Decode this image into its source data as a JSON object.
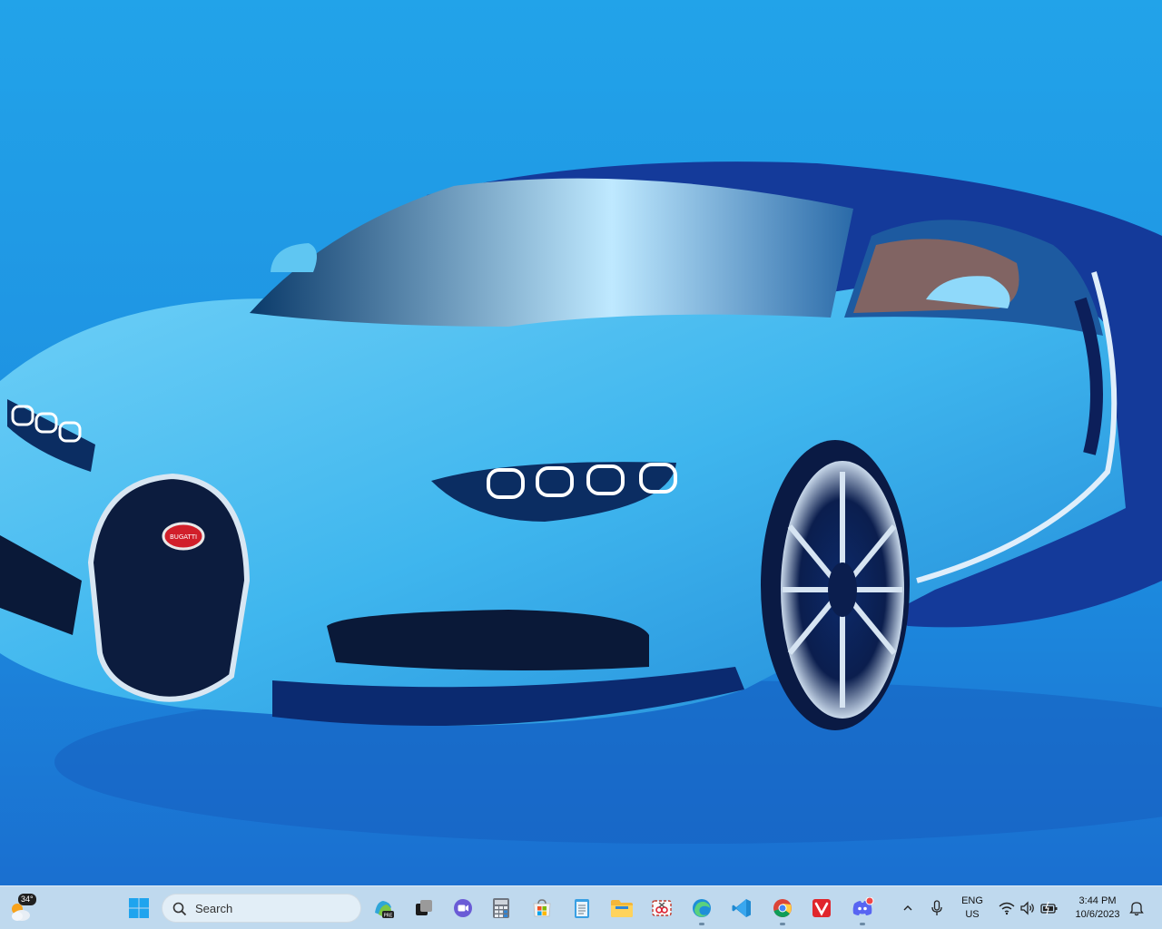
{
  "desktop": {
    "wallpaper_colors": {
      "sky_top": "#22a3e9",
      "sky_bottom": "#1872d4",
      "car_body": "#3fb6ee",
      "car_dark": "#143a9a",
      "badge_red": "#d11f2a"
    },
    "badge_text": "BUGATTI"
  },
  "taskbar": {
    "weather": {
      "temperature": "34°",
      "icon": "weather-sun-cloud-icon"
    },
    "start_icon": "windows-start-icon",
    "search": {
      "label": "Search",
      "icon": "search-icon"
    },
    "apps": [
      {
        "name": "Copilot",
        "icon": "copilot-icon"
      },
      {
        "name": "Task View",
        "icon": "task-view-icon"
      },
      {
        "name": "Teams",
        "icon": "teams-icon"
      },
      {
        "name": "Calculator",
        "icon": "calculator-icon"
      },
      {
        "name": "Microsoft Store",
        "icon": "store-icon"
      },
      {
        "name": "Notepad",
        "icon": "notepad-icon"
      },
      {
        "name": "File Explorer",
        "icon": "folder-icon"
      },
      {
        "name": "Snipping Tool",
        "icon": "snipping-tool-icon"
      },
      {
        "name": "Microsoft Edge",
        "icon": "edge-icon"
      },
      {
        "name": "Visual Studio Code",
        "icon": "vscode-icon"
      },
      {
        "name": "Google Chrome",
        "icon": "chrome-icon"
      },
      {
        "name": "Vivaldi",
        "icon": "vivaldi-icon"
      },
      {
        "name": "Discord",
        "icon": "discord-icon"
      }
    ],
    "tray": {
      "language_line1": "ENG",
      "language_line2": "US",
      "time": "3:44 PM",
      "date": "10/6/2023"
    }
  }
}
